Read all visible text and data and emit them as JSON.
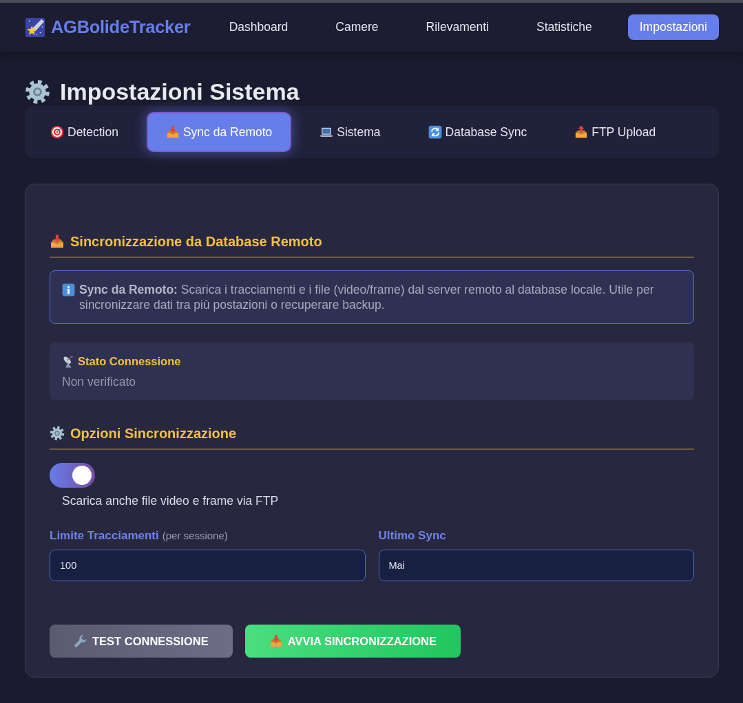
{
  "navbar": {
    "brand": "AGBolideTracker",
    "links": [
      {
        "label": "Dashboard",
        "selected": false
      },
      {
        "label": "Camere",
        "selected": false
      },
      {
        "label": "Rilevamenti",
        "selected": false
      },
      {
        "label": "Statistiche",
        "selected": false
      },
      {
        "label": "Impostazioni",
        "selected": true
      }
    ]
  },
  "page_title": "Impostazioni Sistema",
  "tabs": [
    {
      "label": "Detection",
      "selected": false
    },
    {
      "label": "Sync da Remoto",
      "selected": true
    },
    {
      "label": "Sistema",
      "selected": false
    },
    {
      "label": "Database Sync",
      "selected": false
    },
    {
      "label": "FTP Upload",
      "selected": false
    }
  ],
  "sync_section": {
    "heading": "Sincronizzazione da Database Remoto",
    "info": "**Sync da Remoto:** Scarica i tracciamenti e i file (video/frame) dal server remoto al database locale. Utile per sincronizzare dati tra più postazioni o recuperare backup.",
    "status": {
      "title": "Stato Connessione",
      "value": "Non verificato"
    }
  },
  "options_section": {
    "heading": "Opzioni Sincronizzazione",
    "toggle": {
      "label": "Scarica anche file video e frame via FTP",
      "on": true
    },
    "fields": [
      {
        "label": "Limite Tracciamenti",
        "hint": "(per sessione)",
        "value": "100"
      },
      {
        "label": "Ultimo Sync",
        "value": "Mai"
      }
    ]
  },
  "buttons": [
    {
      "label": "TEST CONNESSIONE",
      "kind": "secondary"
    },
    {
      "label": "AVVIA SINCRONIZZAZIONE",
      "kind": "primary"
    }
  ]
}
